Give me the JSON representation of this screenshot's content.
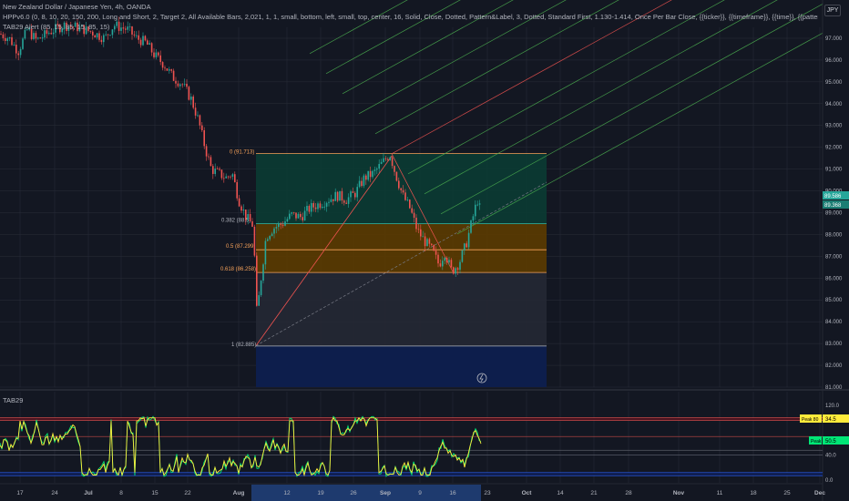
{
  "header": {
    "line1": "New Zealand Dollar / Japanese Yen, 4h, OANDA",
    "line2": "HPPv6.0 (0, 8, 10, 20, 150, 200, Long and Short, 2, Target 2, All Available Bars, 2,021, 1, 1, small, bottom, left, small, top, center, 16, Solid, Close, Dotted, Pattern&Label, 3, Dotted, Standard First, 1.130-1.414, Once Per Bar Close, {{ticker}}, {{timeframe}}, {{time}}, {{pattern}}, New Pattern, Long, Close: {{close}}, Recommended: Entry: {{entry}}, T1: {{target1}}, T2: {{targ",
    "line3": "TAB29 Alert (85, 15, 85, 15, 85, 15)"
  },
  "currency_badge": "JPY",
  "price_axis": {
    "ticks": [
      "97.000",
      "96.000",
      "95.000",
      "94.000",
      "93.000",
      "92.000",
      "91.000",
      "90.000",
      "89.000",
      "88.000",
      "87.000",
      "86.000",
      "85.000",
      "84.000",
      "83.000",
      "82.000",
      "81.000"
    ],
    "values": [
      97,
      96,
      95,
      94,
      93,
      92,
      91,
      90,
      89,
      88,
      87,
      86,
      85,
      84,
      83,
      82,
      81
    ]
  },
  "price_badges": {
    "top": "89.586",
    "bottom": "89.368"
  },
  "fib": {
    "labels": [
      "0 (91.713)",
      "0.382 (88.5)",
      "0.5 (87.299)",
      "0.618 (86.258)",
      "1 (82.885)"
    ],
    "colors": {
      "zero": "#f7a25a",
      "mid": "#f7a25a",
      "one": "#b2b5be"
    }
  },
  "oscillator": {
    "title": "TAB29",
    "ticks": [
      "120.0",
      "40.0",
      "0.0"
    ],
    "tick_values": [
      120,
      40,
      0
    ],
    "badge_upper": [
      "Peak 80",
      "34.5"
    ],
    "badge_lower": [
      "Peak 50",
      "50.5"
    ]
  },
  "time_axis": {
    "labels": [
      "17",
      "24",
      "Jul",
      "8",
      "15",
      "22",
      "Aug",
      "12",
      "19",
      "26",
      "Sep",
      "9",
      "16",
      "23",
      "Oct",
      "14",
      "21",
      "28",
      "Nov",
      "11",
      "18",
      "25",
      "Dec"
    ],
    "bold": [
      "Jul",
      "Aug",
      "Sep",
      "Oct",
      "Nov",
      "Dec"
    ]
  },
  "colors": {
    "bg": "#131722",
    "up": "#26a69a",
    "down": "#ef5350",
    "grid": "#2a2e39",
    "box_green": "#0b3b33",
    "box_orange": "#5c3b00",
    "box_gray": "#252834",
    "box_navy": "#0d1f4f",
    "osc_yellow": "#ffeb3b",
    "osc_green": "#00e676"
  },
  "chart_data": {
    "type": "candlestick",
    "price_axis": {
      "min": 81,
      "max": 97.5
    },
    "trend": [
      [
        0,
        97.2
      ],
      [
        10,
        97.0
      ],
      [
        20,
        96.4
      ],
      [
        30,
        97.4
      ],
      [
        40,
        96.9
      ],
      [
        55,
        97.3
      ],
      [
        70,
        97.6
      ],
      [
        85,
        97.5
      ],
      [
        100,
        97.3
      ],
      [
        115,
        97.0
      ],
      [
        125,
        97.6
      ],
      [
        140,
        97.4
      ],
      [
        150,
        97.0
      ],
      [
        160,
        96.8
      ],
      [
        170,
        96.2
      ],
      [
        180,
        95.8
      ],
      [
        190,
        95.2
      ],
      [
        200,
        94.9
      ],
      [
        210,
        94.2
      ],
      [
        218,
        93.2
      ],
      [
        225,
        92.0
      ],
      [
        232,
        91.0
      ],
      [
        240,
        90.8
      ],
      [
        248,
        90.6
      ],
      [
        255,
        90.8
      ],
      [
        262,
        89.6
      ],
      [
        270,
        88.8
      ],
      [
        278,
        88.4
      ],
      [
        282,
        84.3
      ],
      [
        286,
        85.8
      ],
      [
        292,
        87.9
      ],
      [
        300,
        88.3
      ],
      [
        310,
        88.5
      ],
      [
        320,
        88.9
      ],
      [
        330,
        88.8
      ],
      [
        340,
        89.2
      ],
      [
        350,
        89.4
      ],
      [
        360,
        89.6
      ],
      [
        370,
        89.8
      ],
      [
        380,
        89.6
      ],
      [
        390,
        89.9
      ],
      [
        400,
        90.6
      ],
      [
        410,
        90.8
      ],
      [
        420,
        91.3
      ],
      [
        428,
        91.7
      ],
      [
        434,
        90.8
      ],
      [
        442,
        89.8
      ],
      [
        450,
        89.2
      ],
      [
        458,
        88.2
      ],
      [
        466,
        87.7
      ],
      [
        474,
        87.3
      ],
      [
        482,
        86.6
      ],
      [
        488,
        87.2
      ],
      [
        496,
        86.3
      ],
      [
        504,
        86.7
      ],
      [
        512,
        87.6
      ],
      [
        518,
        88.6
      ],
      [
        524,
        89.6
      ],
      [
        528,
        89.0
      ]
    ],
    "fib_levels": [
      91.713,
      88.5,
      87.299,
      86.258,
      82.885
    ],
    "oscillator": {
      "min": 0,
      "max": 120,
      "upper_band": [
        96,
        100
      ],
      "lower_band": [
        7,
        12
      ],
      "mid_lines": [
        40,
        48,
        70
      ]
    }
  }
}
